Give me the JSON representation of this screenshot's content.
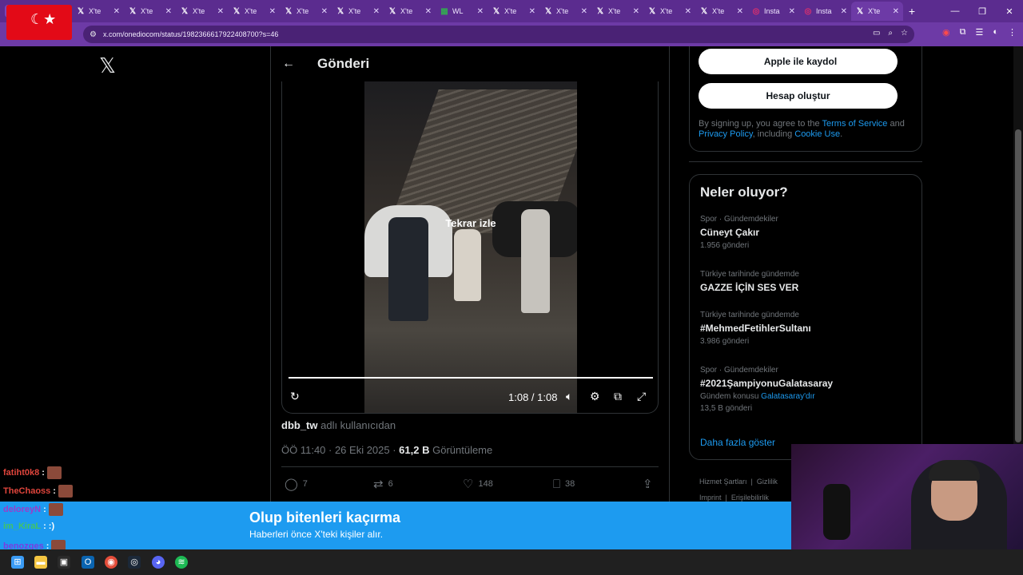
{
  "browser": {
    "tabs": [
      {
        "icon": "x-icon",
        "label": "X'te"
      },
      {
        "icon": "x-icon",
        "label": "X'te"
      },
      {
        "icon": "x-icon",
        "label": "X'te"
      },
      {
        "icon": "x-icon",
        "label": "X'te"
      },
      {
        "icon": "x-icon",
        "label": "X'te"
      },
      {
        "icon": "x-icon",
        "label": "X'te"
      },
      {
        "icon": "x-icon",
        "label": "X'te"
      },
      {
        "icon": "sheets-icon",
        "label": "WL"
      },
      {
        "icon": "x-icon",
        "label": "X'te"
      },
      {
        "icon": "x-icon",
        "label": "X'te"
      },
      {
        "icon": "x-icon",
        "label": "X'te"
      },
      {
        "icon": "x-icon",
        "label": "X'te"
      },
      {
        "icon": "x-icon",
        "label": "X'te"
      },
      {
        "icon": "instagram-icon",
        "label": "Insta"
      },
      {
        "icon": "instagram-icon",
        "label": "Insta"
      },
      {
        "icon": "x-icon",
        "label": "X'te"
      }
    ],
    "url": "x.com/onediocom/status/1982366617922408700?s=46"
  },
  "post": {
    "title": "Gönderi",
    "video": {
      "replay_label": "Tekrar izle",
      "timecode": "1:08 / 1:08",
      "progress": 1.0
    },
    "source": {
      "user": "dbb_tw",
      "suffix": " adlı kullanıcıdan"
    },
    "meta": {
      "time": "ÖÖ 11:40 · 26 Eki 2025 · ",
      "views": "61,2 B",
      "views_label": " Görüntüleme"
    },
    "actions": {
      "replies": "7",
      "reposts": "6",
      "likes": "148",
      "bookmarks": "38"
    }
  },
  "sidebar": {
    "apple_button": "Apple ile kaydol",
    "create_button": "Hesap oluştur",
    "legal": {
      "p1": "By signing up, you agree to the ",
      "terms": "Terms of Service",
      "p2": " and ",
      "privacy": "Privacy Policy",
      "p3": ", including ",
      "cookie": "Cookie Use",
      "p4": "."
    },
    "trends_title": "Neler oluyor?",
    "trends": [
      {
        "category": "Spor · Gündemdekiler",
        "name": "Cüneyt Çakır",
        "count": "1.956 gönderi"
      },
      {
        "category": "Türkiye tarihinde gündemde",
        "name": "GAZZE İÇİN SES VER",
        "count": ""
      },
      {
        "category": "Türkiye tarihinde gündemde",
        "name": "#MehmedFetihlerSultanı",
        "count": "3.986 gönderi"
      },
      {
        "category": "Spor · Gündemdekiler",
        "name": "#2021ŞampiyonuGalatasaray",
        "topic_label": "Gündem konusu",
        "topic_link": "Galatasaray'dır",
        "count": "13,5 B gönderi"
      }
    ],
    "show_more": "Daha fazla göster",
    "footer": [
      "Hizmet Şartları",
      "Gizlilik",
      "Imprint",
      "Erişilebilirlik"
    ]
  },
  "banner": {
    "title": "Olup bitenleri kaçırma",
    "subtitle": "Haberleri önce X'teki kişiler alır."
  },
  "chat": [
    {
      "user": "fatiht0k8",
      "text": ":",
      "color": "#e0453c"
    },
    {
      "user": "TheChaoss",
      "text": ":",
      "color": "#e0453c"
    },
    {
      "user": "deloreyN",
      "text": ":",
      "color": "#9b3cc9"
    },
    {
      "user": "im_KiraL",
      "text": ": :)",
      "color": "#41c463"
    },
    {
      "user": "benozges",
      "text": ":",
      "color": "#7a3ce0"
    }
  ],
  "colors": {
    "accent": "#1d9bf0",
    "browser": "#5b2c8f",
    "background": "#000000"
  }
}
